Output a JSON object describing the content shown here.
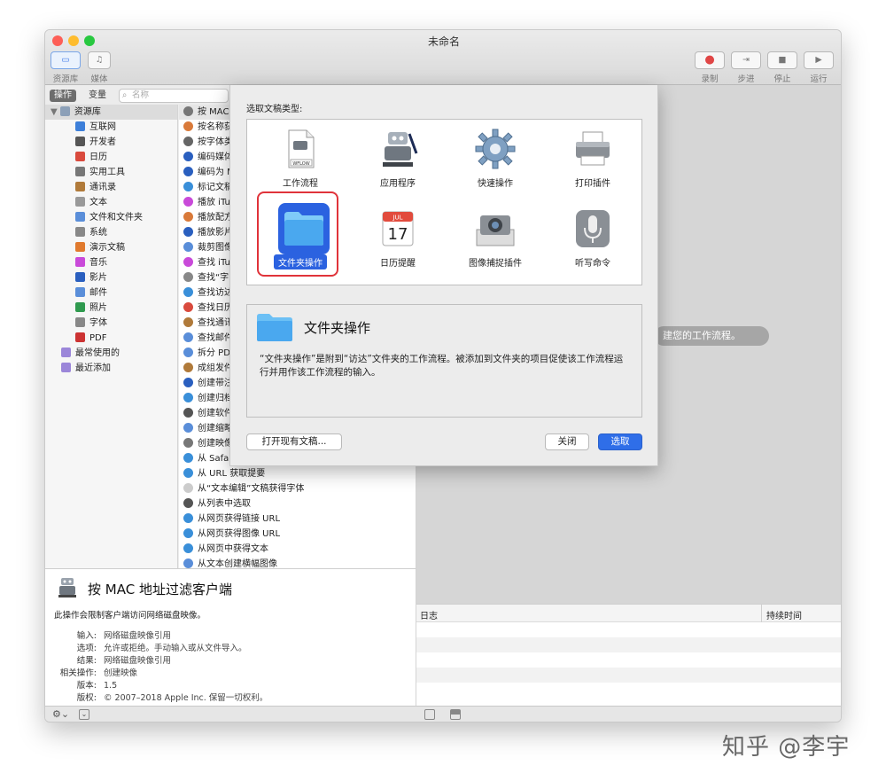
{
  "window": {
    "title": "未命名"
  },
  "toolbar": {
    "library_label": "资源库",
    "media_label": "媒体",
    "record_label": "录制",
    "step_label": "步进",
    "stop_label": "停止",
    "run_label": "运行"
  },
  "tabs": {
    "actions": "操作",
    "variables": "变量"
  },
  "search": {
    "placeholder": "名称"
  },
  "library": {
    "root": "资源库",
    "items": [
      "互联网",
      "开发者",
      "日历",
      "实用工具",
      "通讯录",
      "文本",
      "文件和文件夹",
      "系统",
      "演示文稿",
      "音乐",
      "影片",
      "邮件",
      "照片",
      "字体",
      "PDF"
    ],
    "smart": [
      "最常使用的",
      "最近添加"
    ]
  },
  "actions": {
    "items": [
      "按 MAC",
      "按名称获",
      "按字体类",
      "编码媒体",
      "编码为 M",
      "标记文稿",
      "播放 iTu",
      "播放配方",
      "播放影片",
      "裁剪图像",
      "查找 iTu",
      "查找“字",
      "查找访达",
      "查找日历",
      "查找通讯",
      "查找邮件",
      "拆分 PD",
      "成组发件",
      "创建带注",
      "创建归档",
      "创建软件",
      "创建缩略",
      "创建映像",
      "从 Safari",
      "从 URL 获取提要",
      "从“文本编辑”文稿获得字体",
      "从列表中选取",
      "从网页获得链接 URL",
      "从网页获得图像 URL",
      "从网页中获得文本",
      "从文本创建横幅图像"
    ]
  },
  "workflow": {
    "hint": "建您的工作流程。"
  },
  "description": {
    "title": "按 MAC 地址过滤客户端",
    "summary": "此操作会限制客户端访问网络磁盘映像。",
    "input_k": "输入:",
    "input_v": "网络磁盘映像引用",
    "options_k": "选项:",
    "options_v": "允许或拒绝。手动输入或从文件导入。",
    "result_k": "结果:",
    "result_v": "网络磁盘映像引用",
    "related_k": "相关操作:",
    "related_v": "创建映像",
    "version_k": "版本:",
    "version_v": "1.5",
    "copyright_k": "版权:",
    "copyright_v": "© 2007–2018 Apple Inc. 保留一切权利。"
  },
  "log": {
    "col_log": "日志",
    "col_duration": "持续时间"
  },
  "dialog": {
    "prompt": "选取文稿类型:",
    "types": [
      {
        "label": "工作流程",
        "icon": "workflow-icon"
      },
      {
        "label": "应用程序",
        "icon": "application-icon"
      },
      {
        "label": "快速操作",
        "icon": "gear-icon"
      },
      {
        "label": "打印插件",
        "icon": "printer-icon"
      },
      {
        "label": "文件夹操作",
        "icon": "folder-icon"
      },
      {
        "label": "日历提醒",
        "icon": "calendar-icon"
      },
      {
        "label": "图像捕捉插件",
        "icon": "camera-icon"
      },
      {
        "label": "听写命令",
        "icon": "microphone-icon"
      }
    ],
    "wflow_tag": "WFLOW",
    "cal_month": "JUL",
    "cal_day": "17",
    "selected_title": "文件夹操作",
    "selected_desc": "“文件夹操作”是附到“访达”文件夹的工作流程。被添加到文件夹的项目促使该工作流程运行并用作该工作流程的输入。",
    "open_existing": "打开现有文稿...",
    "close": "关闭",
    "choose": "选取"
  },
  "watermark": "知乎 @李宇",
  "colors": {
    "accent": "#2b62e0",
    "highlight_ring": "#e0333a",
    "folder_blue": "#4aa8ef"
  }
}
